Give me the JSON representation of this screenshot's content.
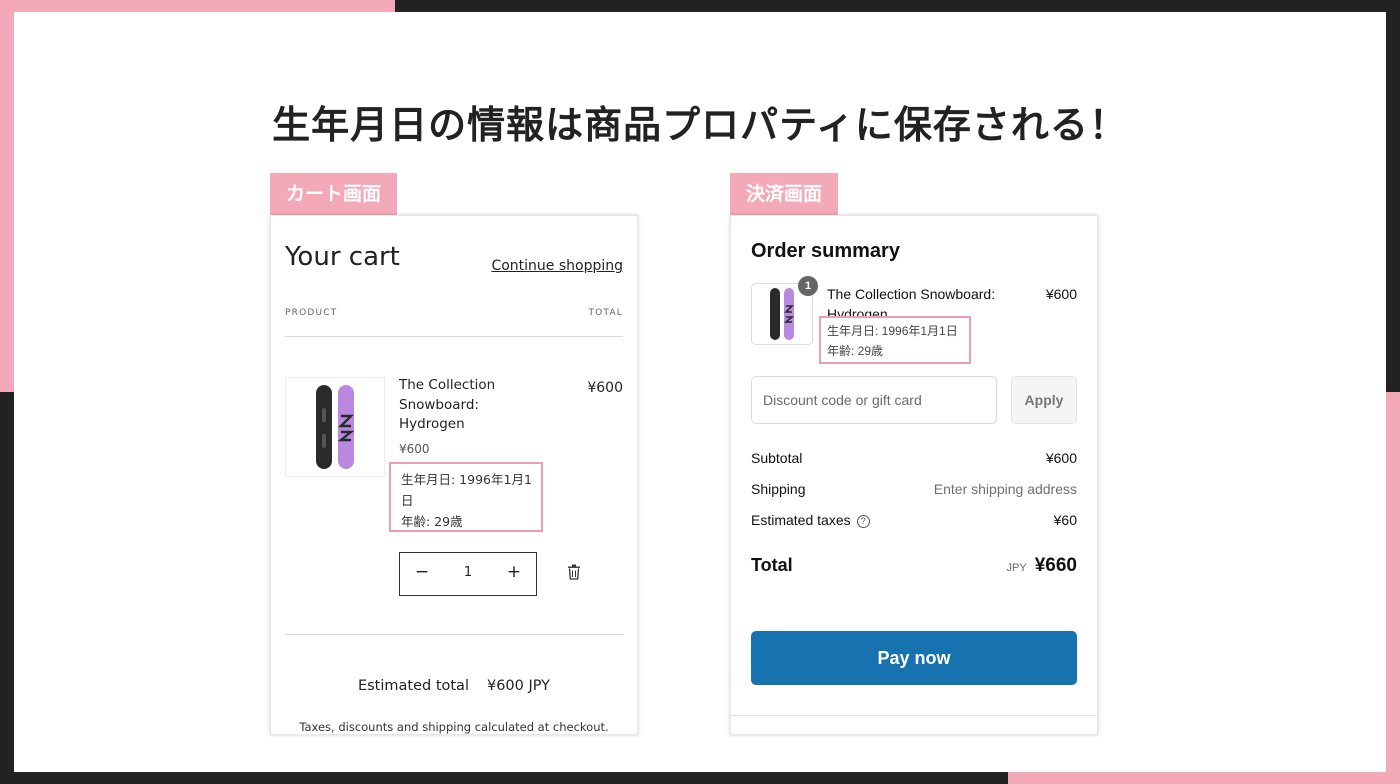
{
  "headline": "生年月日の情報は商品プロパティに保存される！",
  "cart_tab": "カート画面",
  "checkout_tab": "決済画面",
  "cart": {
    "title": "Your cart",
    "continue_link": "Continue shopping",
    "col_product": "PRODUCT",
    "col_total": "TOTAL",
    "item": {
      "name": "The Collection Snowboard: Hydrogen",
      "unit_price": "¥600",
      "line_total": "¥600",
      "property_birth": "生年月日: 1996年1月1日",
      "property_age": "年齢: 29歳"
    },
    "quantity": {
      "minus": "−",
      "value": "1",
      "plus": "+"
    },
    "estimated_label": "Estimated total",
    "estimated_value": "¥600 JPY",
    "note": "Taxes, discounts and shipping calculated at checkout."
  },
  "checkout": {
    "title": "Order summary",
    "item": {
      "badge": "1",
      "name": "The Collection Snowboard: Hydrogen",
      "price": "¥600",
      "property_birth": "生年月日: 1996年1月1日",
      "property_age": "年齢: 29歳"
    },
    "discount_placeholder": "Discount code or gift card",
    "apply_label": "Apply",
    "subtotal_label": "Subtotal",
    "subtotal_value": "¥600",
    "shipping_label": "Shipping",
    "shipping_value": "Enter shipping address",
    "taxes_label": "Estimated taxes",
    "taxes_value": "¥60",
    "info_glyph": "?",
    "total_label": "Total",
    "total_currency": "JPY",
    "total_value": "¥660",
    "pay_label": "Pay now"
  },
  "colors": {
    "pink_accent": "#f4a9b8",
    "pay_button": "#1773b0",
    "board_purple": "#b989df",
    "board_black": "#2a2a2a"
  }
}
